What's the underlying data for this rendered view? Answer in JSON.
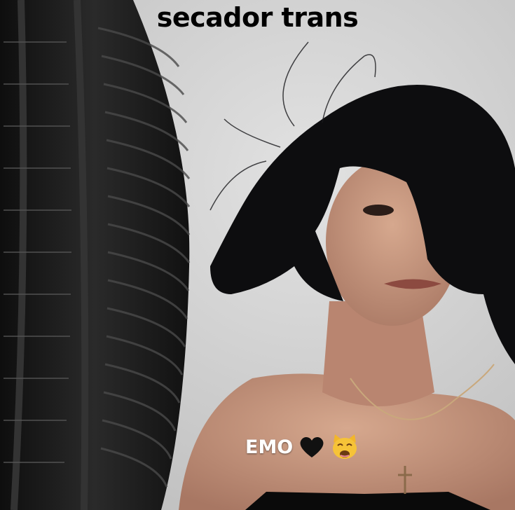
{
  "caption_top": "secador trans",
  "caption_bottom": "EMO",
  "icons": {
    "heart": "black-heart-icon",
    "cat": "weary-cat-face-icon"
  },
  "colors": {
    "wall": "#d6d6d6",
    "fan": "#1a1a1a",
    "hair": "#0d0d0f",
    "skin": "#c99a80",
    "caption_top": "#000000",
    "caption_bottom": "#ffffff"
  }
}
